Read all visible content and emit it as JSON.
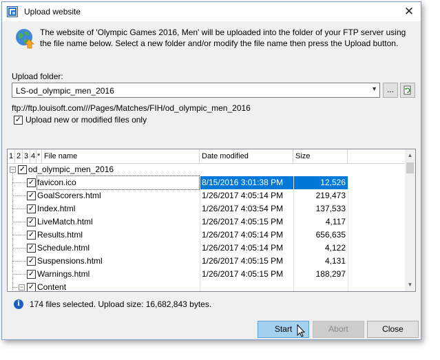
{
  "window": {
    "title": "Upload website",
    "close_symbol": "✕"
  },
  "description": "The website of 'Olympic Games 2016, Men' will be uploaded into the folder of your FTP server using the file name below. Select a new folder and/or modify the file name then press the Upload button.",
  "upload_folder": {
    "label": "Upload folder:",
    "value": "LS-od_olympic_men_2016",
    "browse_label": "...",
    "url": "ftp://ftp.louisoft.com///Pages/Matches/FIH/od_olympic_men_2016"
  },
  "option": {
    "label": "Upload new or modified files only",
    "checked": true
  },
  "grid": {
    "columns": {
      "c1": "1",
      "c2": "2",
      "c3": "3",
      "c4": "4",
      "star": "*",
      "name": "File name",
      "date": "Date modified",
      "size": "Size"
    },
    "root": "od_olympic_men_2016",
    "rows": [
      {
        "name": "favicon.ico",
        "date": "8/15/2016 3:01:38 PM",
        "size": "12,526",
        "selected": true
      },
      {
        "name": "GoalScorers.html",
        "date": "1/26/2017 4:05:14 PM",
        "size": "219,473"
      },
      {
        "name": "Index.html",
        "date": "1/26/2017 4:03:54 PM",
        "size": "137,533"
      },
      {
        "name": "LiveMatch.html",
        "date": "1/26/2017 4:05:15 PM",
        "size": "4,117"
      },
      {
        "name": "Results.html",
        "date": "1/26/2017 4:05:14 PM",
        "size": "656,635"
      },
      {
        "name": "Schedule.html",
        "date": "1/26/2017 4:05:14 PM",
        "size": "4,122"
      },
      {
        "name": "Suspensions.html",
        "date": "1/26/2017 4:05:15 PM",
        "size": "4,131"
      },
      {
        "name": "Warnings.html",
        "date": "1/26/2017 4:05:15 PM",
        "size": "188,297"
      }
    ],
    "folder": "Content"
  },
  "status": "174 files selected. Upload size: 16,682,843 bytes.",
  "buttons": {
    "start": "Start",
    "abort": "Abort",
    "close": "Close"
  },
  "colors": {
    "selection": "#0078d7",
    "start_button": "#a4d1f0"
  }
}
